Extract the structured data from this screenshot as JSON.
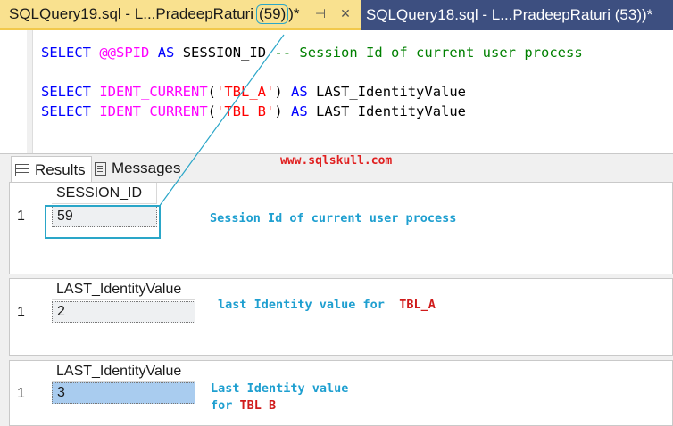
{
  "tabs": {
    "active": {
      "title": "SQLQuery19.sql - L...PradeepRaturi",
      "spid": "(59)",
      "suffix": ")*"
    },
    "inactive": {
      "title": "SQLQuery18.sql - L...PradeepRaturi (53))*"
    }
  },
  "editor": {
    "line1": {
      "kw1": "SELECT",
      "fn": "@@SPID",
      "kw2": "AS",
      "ident": "SESSION_ID",
      "comment": "-- Session Id of current user process"
    },
    "line2": {
      "kw1": "SELECT",
      "fn": "IDENT_CURRENT",
      "open": "(",
      "str": "'TBL_A'",
      "close": ")",
      "kw2": "AS",
      "ident": "LAST_IdentityValue"
    },
    "line3": {
      "kw1": "SELECT",
      "fn": "IDENT_CURRENT",
      "open": "(",
      "str": "'TBL_B'",
      "close": ")",
      "kw2": "AS",
      "ident": "LAST_IdentityValue"
    }
  },
  "results": {
    "tab_results": "Results",
    "tab_messages": "Messages",
    "watermark": "www.sqlskull.com",
    "grids": [
      {
        "column": "SESSION_ID",
        "row_number": "1",
        "value": "59"
      },
      {
        "column": "LAST_IdentityValue",
        "row_number": "1",
        "value": "2"
      },
      {
        "column": "LAST_IdentityValue",
        "row_number": "1",
        "value": "3"
      }
    ],
    "annotations": {
      "a1": "Session Id of current user process",
      "a2_blue": "last Identity value for  ",
      "a2_red": "TBL_A",
      "a3_line1": "Last Identity value",
      "a3_blue": "for ",
      "a3_red": "TBL B"
    }
  },
  "colors": {
    "tab_active_bg": "#f9e18f",
    "tab_strip_bg": "#2f3d6b",
    "annotation_blue": "#1e9fd0",
    "annotation_red": "#d01b1b",
    "selected_cell": "#a9ccef"
  }
}
